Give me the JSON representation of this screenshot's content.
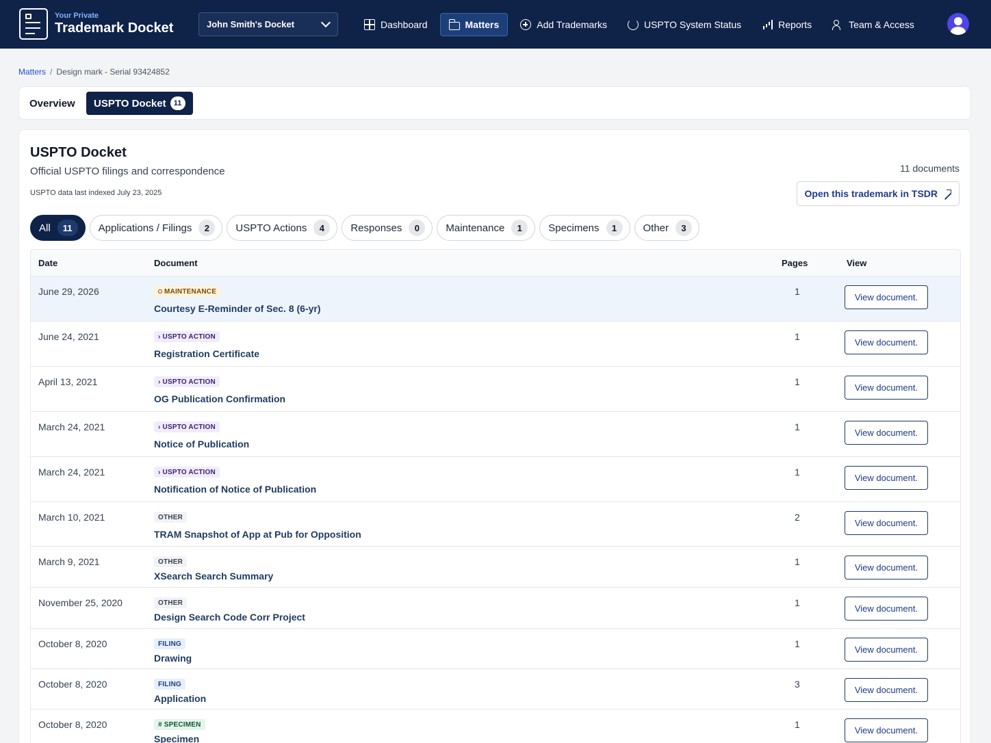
{
  "brand": {
    "subtitle": "Your Private",
    "title": "Trademark Docket"
  },
  "docket_selector": {
    "label": "John Smith's Docket"
  },
  "nav": [
    {
      "label": "Dashboard",
      "icon": "grid-icon"
    },
    {
      "label": "Matters",
      "icon": "folder-icon",
      "active": true
    },
    {
      "label": "Add Trademarks",
      "icon": "plus-circle-icon"
    },
    {
      "label": "USPTO System Status",
      "icon": "sync-icon"
    },
    {
      "label": "Reports",
      "icon": "bar-chart-icon"
    },
    {
      "label": "Team & Access",
      "icon": "users-icon"
    }
  ],
  "breadcrumb": {
    "root": "Matters",
    "separator": "/",
    "current": "Design mark - Serial 93424852"
  },
  "tabs": {
    "overview": "Overview",
    "docket": "USPTO Docket",
    "docket_count": "11"
  },
  "section": {
    "title": "USPTO Docket",
    "subtitle": "Official USPTO filings and correspondence",
    "indexed": "USPTO data last indexed July 23, 2025",
    "doc_count": "11 documents",
    "tsdr_button": "Open this trademark in TSDR"
  },
  "filters": [
    {
      "label": "All",
      "count": "11",
      "active": true
    },
    {
      "label": "Applications / Filings",
      "count": "2"
    },
    {
      "label": "USPTO Actions",
      "count": "4"
    },
    {
      "label": "Responses",
      "count": "0"
    },
    {
      "label": "Maintenance",
      "count": "1"
    },
    {
      "label": "Specimens",
      "count": "1"
    },
    {
      "label": "Other",
      "count": "3"
    }
  ],
  "table": {
    "headers": {
      "date": "Date",
      "document": "Document",
      "pages": "Pages",
      "view": "View"
    },
    "view_label": "View document.",
    "rows": [
      {
        "date": "June 29, 2026",
        "badge": "MAINTENANCE",
        "badge_type": "maintenance",
        "title": "Courtesy E-Reminder of Sec. 8 (6-yr)",
        "pages": "1"
      },
      {
        "date": "June 24, 2021",
        "badge": "USPTO ACTION",
        "badge_type": "uspto",
        "title": "Registration Certificate",
        "pages": "1"
      },
      {
        "date": "April 13, 2021",
        "badge": "USPTO ACTION",
        "badge_type": "uspto",
        "title": "OG Publication Confirmation",
        "pages": "1"
      },
      {
        "date": "March 24, 2021",
        "badge": "USPTO ACTION",
        "badge_type": "uspto",
        "title": "Notice of Publication",
        "pages": "1"
      },
      {
        "date": "March 24, 2021",
        "badge": "USPTO ACTION",
        "badge_type": "uspto",
        "title": "Notification of Notice of Publication",
        "pages": "1"
      },
      {
        "date": "March 10, 2021",
        "badge": "OTHER",
        "badge_type": "other",
        "title": "TRAM Snapshot of App at Pub for Opposition",
        "pages": "2"
      },
      {
        "date": "March 9, 2021",
        "badge": "OTHER",
        "badge_type": "other",
        "title": "XSearch Search Summary",
        "pages": "1"
      },
      {
        "date": "November 25, 2020",
        "badge": "OTHER",
        "badge_type": "other",
        "title": "Design Search Code Corr Project",
        "pages": "1"
      },
      {
        "date": "October 8, 2020",
        "badge": "FILING",
        "badge_type": "filing",
        "title": "Drawing",
        "pages": "1"
      },
      {
        "date": "October 8, 2020",
        "badge": "FILING",
        "badge_type": "filing",
        "title": "Application",
        "pages": "3"
      },
      {
        "date": "October 8, 2020",
        "badge": "SPECIMEN",
        "badge_type": "specimen",
        "title": "Specimen",
        "pages": "1"
      }
    ]
  }
}
